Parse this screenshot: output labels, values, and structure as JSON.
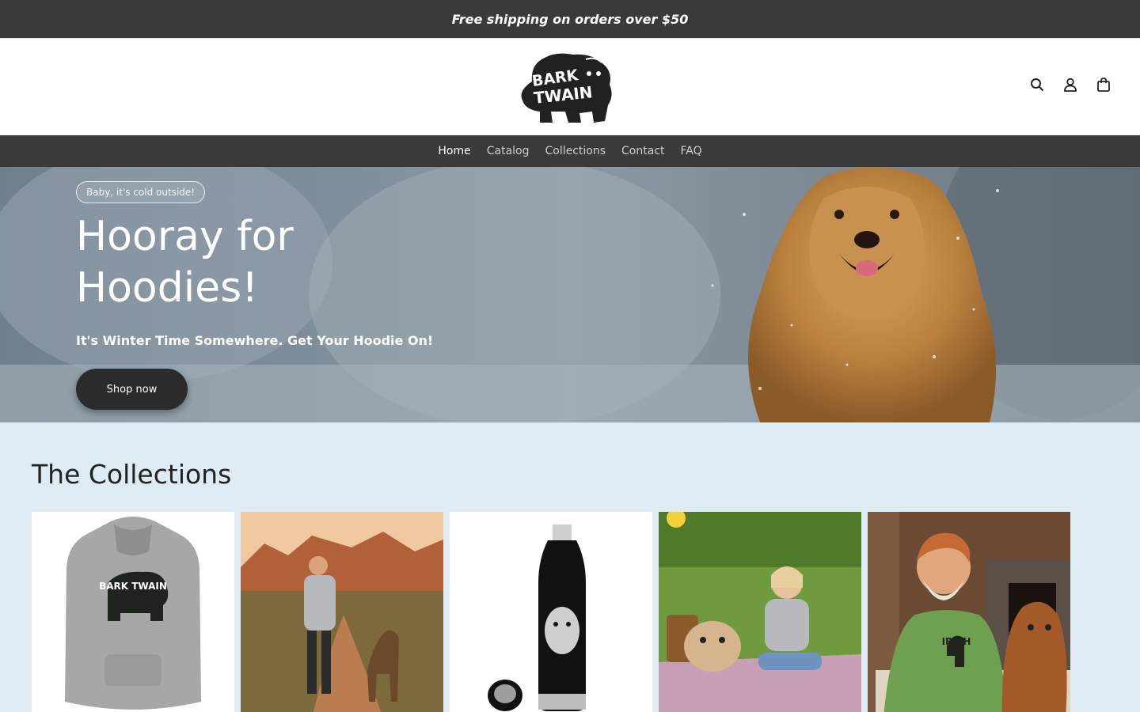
{
  "announcement": {
    "text": "Free shipping on orders over $50"
  },
  "brand": {
    "logo_line1": "BARK",
    "logo_line2": "TWAIN"
  },
  "header_icons": [
    "search-icon",
    "account-icon",
    "cart-icon"
  ],
  "nav": {
    "items": [
      {
        "label": "Home",
        "active": true
      },
      {
        "label": "Catalog",
        "active": false
      },
      {
        "label": "Collections",
        "active": false
      },
      {
        "label": "Contact",
        "active": false
      },
      {
        "label": "FAQ",
        "active": false
      }
    ]
  },
  "hero": {
    "badge": "Baby, it's cold outside!",
    "title": "Hooray for Hoodies!",
    "subtitle": "It's Winter Time Somewhere. Get Your Hoodie On!",
    "cta": "Shop now"
  },
  "collections": {
    "heading": "The Collections",
    "cards": [
      {
        "name": "grey-bulldog-hoodie",
        "shirt_text": "BARK TWAIN"
      },
      {
        "name": "woman-walking-shepherd"
      },
      {
        "name": "black-water-bottle"
      },
      {
        "name": "girl-with-french-bulldog"
      },
      {
        "name": "man-with-irish-terrier",
        "shirt_text": "IRISH"
      }
    ]
  },
  "colors": {
    "dark_bar": "#3a3a3a",
    "page_bg": "#dfebf3",
    "button": "#2b2b2b"
  }
}
